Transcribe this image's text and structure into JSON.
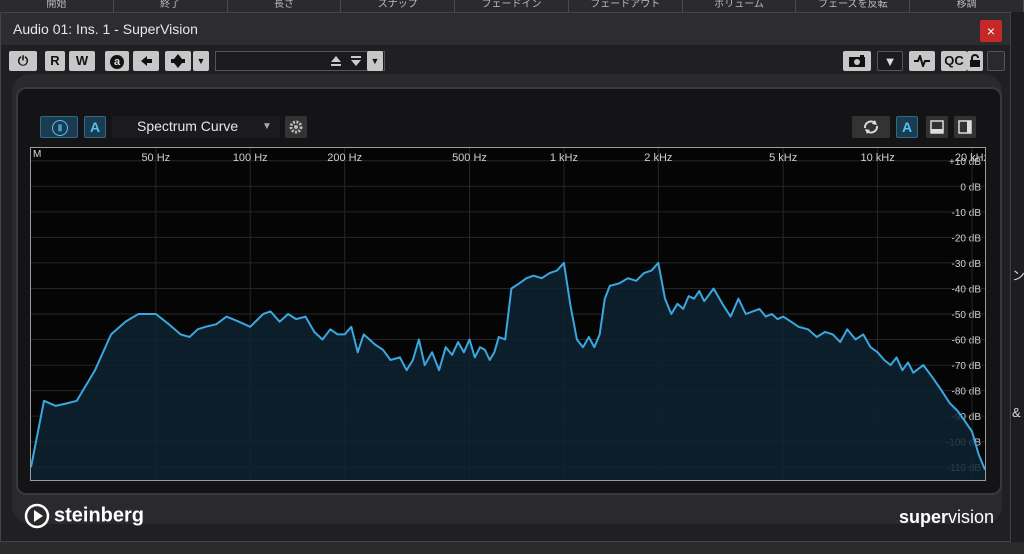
{
  "background": {
    "header_columns": [
      "開始",
      "終了",
      "長さ",
      "スナップ",
      "フェードイン",
      "フェードアウト",
      "ボリューム",
      "フェーズを反転",
      "移調"
    ],
    "right_edge_chars": [
      "ン",
      "&"
    ]
  },
  "window": {
    "title": "Audio 01: Ins. 1 - SuperVision",
    "close_label": "×"
  },
  "toolbar": {
    "power_label": "⏻",
    "read_label": "R",
    "write_label": "W",
    "auto_label": "a",
    "preset_value": "",
    "qc_label": "QC",
    "dropdown_arrow": "▼"
  },
  "plugin": {
    "pause_label": "Ⅱ",
    "auto_label": "A",
    "display_name": "Spectrum Curve",
    "mode_label": "M",
    "brand_left": "steinberg",
    "brand_right_1": "super",
    "brand_right_2": "vision"
  },
  "chart_data": {
    "type": "line",
    "x_scale": "log",
    "x_ticks": [
      "50 Hz",
      "100 Hz",
      "200 Hz",
      "500 Hz",
      "1 kHz",
      "2 kHz",
      "5 kHz",
      "10 kHz",
      "20 kHz"
    ],
    "x_tick_values": [
      50,
      100,
      200,
      500,
      1000,
      2000,
      5000,
      10000,
      20000
    ],
    "y_ticks": [
      "+10 dB",
      "0 dB",
      "-10 dB",
      "-20 dB",
      "-30 dB",
      "-40 dB",
      "-50 dB",
      "-60 dB",
      "-70 dB",
      "-80 dB",
      "-90 dB",
      "-100 dB",
      "-110 dB"
    ],
    "y_tick_values": [
      10,
      0,
      -10,
      -20,
      -30,
      -40,
      -50,
      -60,
      -70,
      -80,
      -90,
      -100,
      -110
    ],
    "xlim": [
      20,
      22000
    ],
    "ylim": [
      -115,
      15
    ],
    "grid": true,
    "color": "#3aa7e0",
    "points": [
      [
        20,
        -110
      ],
      [
        22,
        -84
      ],
      [
        24,
        -86
      ],
      [
        26,
        -85
      ],
      [
        28,
        -84
      ],
      [
        32,
        -72
      ],
      [
        36,
        -58
      ],
      [
        40,
        -53
      ],
      [
        44,
        -50
      ],
      [
        50,
        -50
      ],
      [
        55,
        -54
      ],
      [
        60,
        -58
      ],
      [
        64,
        -59
      ],
      [
        68,
        -56
      ],
      [
        72,
        -55
      ],
      [
        78,
        -54
      ],
      [
        84,
        -51
      ],
      [
        92,
        -53
      ],
      [
        100,
        -55
      ],
      [
        110,
        -50
      ],
      [
        116,
        -49
      ],
      [
        124,
        -53
      ],
      [
        132,
        -50
      ],
      [
        140,
        -52
      ],
      [
        150,
        -51
      ],
      [
        160,
        -57
      ],
      [
        170,
        -60
      ],
      [
        180,
        -56
      ],
      [
        190,
        -58
      ],
      [
        200,
        -58
      ],
      [
        210,
        -55
      ],
      [
        220,
        -65
      ],
      [
        230,
        -58
      ],
      [
        240,
        -60
      ],
      [
        250,
        -62
      ],
      [
        265,
        -64
      ],
      [
        280,
        -68
      ],
      [
        300,
        -67
      ],
      [
        315,
        -72
      ],
      [
        330,
        -68
      ],
      [
        345,
        -60
      ],
      [
        360,
        -70
      ],
      [
        380,
        -65
      ],
      [
        400,
        -72
      ],
      [
        420,
        -63
      ],
      [
        440,
        -66
      ],
      [
        460,
        -61
      ],
      [
        480,
        -65
      ],
      [
        500,
        -60
      ],
      [
        520,
        -67
      ],
      [
        540,
        -63
      ],
      [
        560,
        -64
      ],
      [
        580,
        -68
      ],
      [
        600,
        -65
      ],
      [
        620,
        -59
      ],
      [
        650,
        -60
      ],
      [
        680,
        -40
      ],
      [
        720,
        -38
      ],
      [
        760,
        -36
      ],
      [
        800,
        -35
      ],
      [
        850,
        -36
      ],
      [
        900,
        -34
      ],
      [
        950,
        -33
      ],
      [
        1000,
        -30
      ],
      [
        1050,
        -47
      ],
      [
        1100,
        -60
      ],
      [
        1150,
        -63
      ],
      [
        1200,
        -59
      ],
      [
        1250,
        -63
      ],
      [
        1300,
        -58
      ],
      [
        1350,
        -44
      ],
      [
        1400,
        -39
      ],
      [
        1500,
        -38
      ],
      [
        1600,
        -36
      ],
      [
        1700,
        -37
      ],
      [
        1800,
        -34
      ],
      [
        1900,
        -33
      ],
      [
        2000,
        -30
      ],
      [
        2100,
        -44
      ],
      [
        2200,
        -50
      ],
      [
        2300,
        -46
      ],
      [
        2400,
        -48
      ],
      [
        2500,
        -43
      ],
      [
        2600,
        -44
      ],
      [
        2700,
        -41
      ],
      [
        2800,
        -45
      ],
      [
        3000,
        -40
      ],
      [
        3200,
        -46
      ],
      [
        3400,
        -51
      ],
      [
        3600,
        -44
      ],
      [
        3800,
        -50
      ],
      [
        4000,
        -49
      ],
      [
        4200,
        -48
      ],
      [
        4400,
        -51
      ],
      [
        4600,
        -50
      ],
      [
        4800,
        -52
      ],
      [
        5000,
        -51
      ],
      [
        5300,
        -53
      ],
      [
        5600,
        -55
      ],
      [
        6000,
        -56
      ],
      [
        6400,
        -59
      ],
      [
        6800,
        -57
      ],
      [
        7200,
        -58
      ],
      [
        7600,
        -61
      ],
      [
        8000,
        -56
      ],
      [
        8500,
        -60
      ],
      [
        9000,
        -58
      ],
      [
        9500,
        -63
      ],
      [
        10000,
        -65
      ],
      [
        10500,
        -68
      ],
      [
        11000,
        -70
      ],
      [
        11500,
        -67
      ],
      [
        12000,
        -72
      ],
      [
        12500,
        -69
      ],
      [
        13000,
        -73
      ],
      [
        14000,
        -70
      ],
      [
        15000,
        -75
      ],
      [
        16000,
        -80
      ],
      [
        17000,
        -85
      ],
      [
        18000,
        -88
      ],
      [
        19000,
        -92
      ],
      [
        20000,
        -96
      ],
      [
        21000,
        -105
      ],
      [
        22000,
        -111
      ]
    ]
  }
}
